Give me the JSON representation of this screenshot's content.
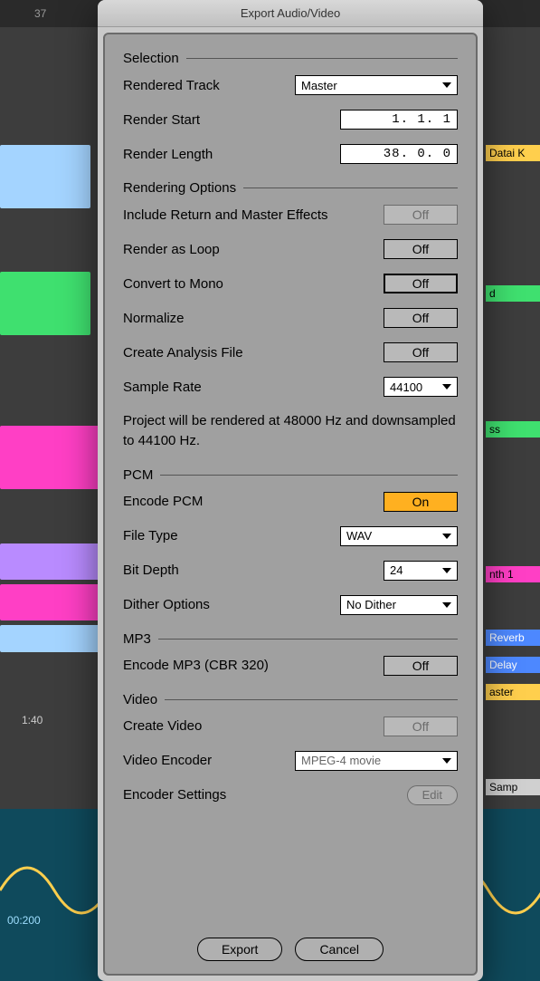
{
  "title": "Export Audio/Video",
  "background": {
    "ruler_mark": "37",
    "timecode": "1:40",
    "wave_time": "00:200",
    "track_labels": [
      "Datai K",
      "d",
      "ss",
      "nth 1",
      "Reverb",
      "Delay",
      "aster",
      "Samp"
    ]
  },
  "sections": {
    "selection": {
      "heading": "Selection",
      "rendered_track": {
        "label": "Rendered Track",
        "value": "Master"
      },
      "render_start": {
        "label": "Render Start",
        "value": "1.  1.  1"
      },
      "render_length": {
        "label": "Render Length",
        "value": "38.  0.  0"
      }
    },
    "rendering": {
      "heading": "Rendering Options",
      "include_return": {
        "label": "Include Return and Master Effects",
        "value": "Off"
      },
      "render_loop": {
        "label": "Render as Loop",
        "value": "Off"
      },
      "mono": {
        "label": "Convert to Mono",
        "value": "Off"
      },
      "normalize": {
        "label": "Normalize",
        "value": "Off"
      },
      "analysis": {
        "label": "Create Analysis File",
        "value": "Off"
      },
      "sample_rate": {
        "label": "Sample Rate",
        "value": "44100"
      },
      "note": "Project will be rendered at 48000 Hz and downsampled to 44100 Hz."
    },
    "pcm": {
      "heading": "PCM",
      "encode": {
        "label": "Encode PCM",
        "value": "On"
      },
      "filetype": {
        "label": "File Type",
        "value": "WAV"
      },
      "bitdepth": {
        "label": "Bit Depth",
        "value": "24"
      },
      "dither": {
        "label": "Dither Options",
        "value": "No Dither"
      }
    },
    "mp3": {
      "heading": "MP3",
      "encode": {
        "label": "Encode MP3 (CBR 320)",
        "value": "Off"
      }
    },
    "video": {
      "heading": "Video",
      "create": {
        "label": "Create Video",
        "value": "Off"
      },
      "encoder": {
        "label": "Video Encoder",
        "value": "MPEG-4 movie"
      },
      "settings": {
        "label": "Encoder Settings",
        "button": "Edit"
      }
    }
  },
  "footer": {
    "export": "Export",
    "cancel": "Cancel"
  }
}
